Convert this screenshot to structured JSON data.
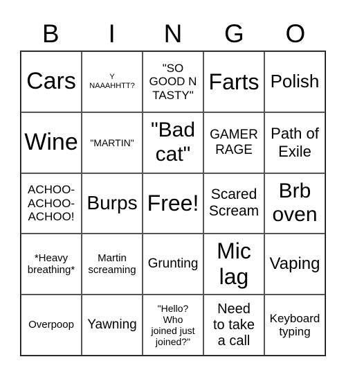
{
  "header": [
    "B",
    "I",
    "N",
    "G",
    "O"
  ],
  "cells": [
    "Cars",
    "Y\nNAAAHHTT?",
    "\"SO\nGOOD N\nTASTY\"",
    "Farts",
    "Polish",
    "Wine",
    "\"MARTIN\"",
    "\"Bad\ncat\"",
    "GAMER\nRAGE",
    "Path of\nExile",
    "ACHOO-\nACHOO-\nACHOO!",
    "Burps",
    "Free!",
    "Scared\nScream",
    "Brb\noven",
    "*Heavy\nbreathing*",
    "Martin\nscreaming",
    "Grunting",
    "Mic\nlag",
    "Vaping",
    "Overpoop",
    "Yawning",
    "\"Hello?\nWho\njoined just\njoined?\"",
    "Need\nto take\na call",
    "Keyboard\ntyping"
  ]
}
